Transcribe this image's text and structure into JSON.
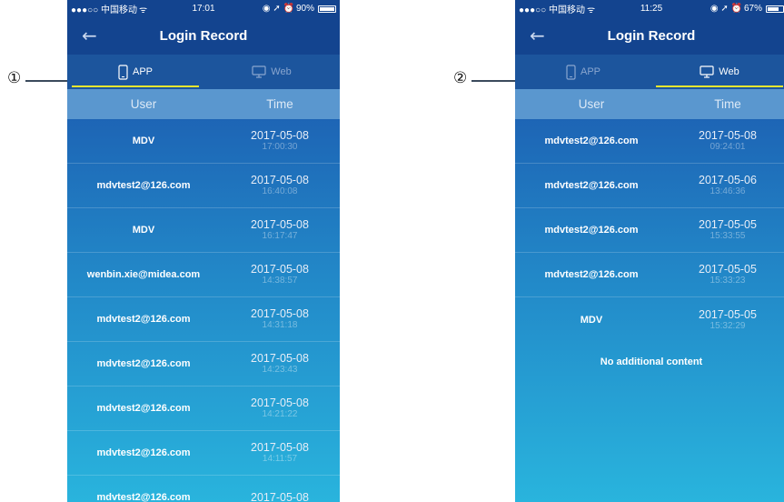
{
  "callouts": {
    "left": "①",
    "right": "②"
  },
  "left_screen": {
    "status": {
      "carrier": "●●●○○ 中国移动",
      "wifi": "ᯤ",
      "time": "17:01",
      "icons": "◉ ➚ ⏰",
      "battery": "90%",
      "battery_level": 0.9
    },
    "nav": {
      "back": "←",
      "title": "Login Record"
    },
    "tabs": [
      {
        "label": "APP",
        "active": true
      },
      {
        "label": "Web",
        "active": false
      }
    ],
    "columns": {
      "user": "User",
      "time": "Time"
    },
    "rows": [
      {
        "user": "MDV",
        "date": "2017-05-08",
        "clock": "17:00:30"
      },
      {
        "user": "mdvtest2@126.com",
        "date": "2017-05-08",
        "clock": "16:40:08"
      },
      {
        "user": "MDV",
        "date": "2017-05-08",
        "clock": "16:17:47"
      },
      {
        "user": "wenbin.xie@midea.com",
        "date": "2017-05-08",
        "clock": "14:38:57"
      },
      {
        "user": "mdvtest2@126.com",
        "date": "2017-05-08",
        "clock": "14:31:18"
      },
      {
        "user": "mdvtest2@126.com",
        "date": "2017-05-08",
        "clock": "14:23:43"
      },
      {
        "user": "mdvtest2@126.com",
        "date": "2017-05-08",
        "clock": "14:21:22"
      },
      {
        "user": "mdvtest2@126.com",
        "date": "2017-05-08",
        "clock": "14:11:57"
      },
      {
        "user": "mdvtest2@126.com",
        "date": "2017-05-08",
        "clock": ""
      }
    ]
  },
  "right_screen": {
    "status": {
      "carrier": "●●●○○ 中国移动",
      "wifi": "ᯤ",
      "time": "11:25",
      "icons": "◉ ➚ ⏰",
      "battery": "67%",
      "battery_level": 0.67
    },
    "nav": {
      "back": "←",
      "title": "Login Record"
    },
    "tabs": [
      {
        "label": "APP",
        "active": false
      },
      {
        "label": "Web",
        "active": true
      }
    ],
    "columns": {
      "user": "User",
      "time": "Time"
    },
    "rows": [
      {
        "user": "mdvtest2@126.com",
        "date": "2017-05-08",
        "clock": "09:24:01"
      },
      {
        "user": "mdvtest2@126.com",
        "date": "2017-05-06",
        "clock": "13:46:36"
      },
      {
        "user": "mdvtest2@126.com",
        "date": "2017-05-05",
        "clock": "15:33:55"
      },
      {
        "user": "mdvtest2@126.com",
        "date": "2017-05-05",
        "clock": "15:33:23"
      },
      {
        "user": "MDV",
        "date": "2017-05-05",
        "clock": "15:32:29"
      }
    ],
    "footer": "No additional content"
  }
}
